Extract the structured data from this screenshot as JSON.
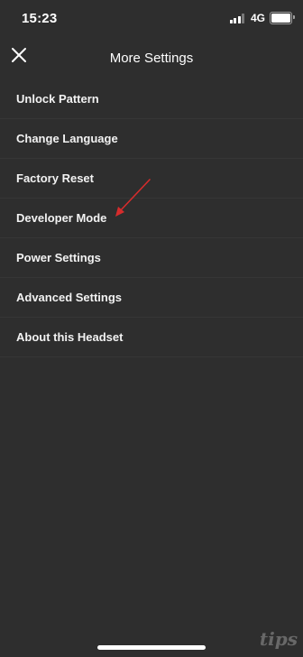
{
  "status_bar": {
    "time": "15:23",
    "network": "4G",
    "signal_bars_active": 3,
    "signal_bars_total": 4,
    "battery_level": 1.0
  },
  "header": {
    "title": "More Settings",
    "close_icon": "close-icon"
  },
  "settings": {
    "items": [
      {
        "label": "Unlock Pattern"
      },
      {
        "label": "Change Language"
      },
      {
        "label": "Factory Reset"
      },
      {
        "label": "Developer Mode"
      },
      {
        "label": "Power Settings"
      },
      {
        "label": "Advanced Settings"
      },
      {
        "label": "About this Headset"
      }
    ]
  },
  "annotation": {
    "icon": "red-arrow-icon",
    "target": "Developer Mode",
    "color": "#d62c2c"
  },
  "watermark": {
    "text": "tips"
  },
  "colors": {
    "background": "#2e2e2e",
    "divider": "#363636",
    "text": "#ffffff"
  }
}
